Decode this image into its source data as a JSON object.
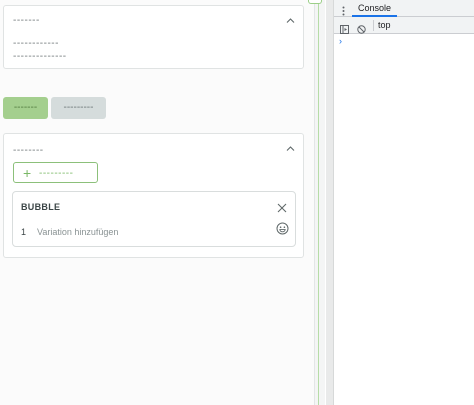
{
  "app": {
    "section1": {
      "title": "-------",
      "line1": "------------",
      "line2": "--------------"
    },
    "buttons": {
      "green_label": "-------",
      "grey_label": "---------"
    },
    "section2": {
      "title": "--------",
      "add_label": "---------",
      "bubble": {
        "title": "BUBBLE",
        "variation_number": "1",
        "variation_placeholder": "Variation hinzufügen"
      }
    }
  },
  "devtools": {
    "tab_console": "Console",
    "context": "top",
    "prompt_symbol": "›"
  },
  "colors": {
    "accent_green": "#8cc07a",
    "devtools_blue": "#1a73e8"
  },
  "icons": [
    "chevron-up-icon",
    "plus-icon",
    "close-icon",
    "emoji-icon",
    "kebab-menu-icon",
    "sidebar-toggle-icon",
    "clear-console-icon"
  ]
}
